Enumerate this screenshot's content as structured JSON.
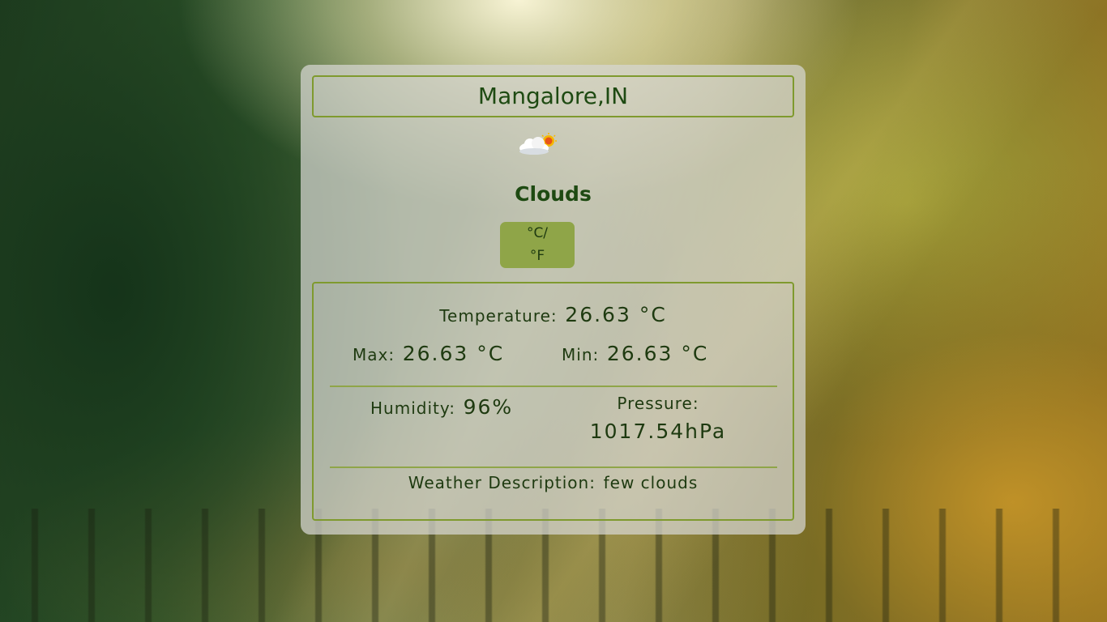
{
  "location": {
    "city_label": "Mangalore,IN"
  },
  "weather": {
    "icon": "cloud-sun-icon",
    "condition": "Clouds"
  },
  "unit_toggle": {
    "celsius": "°C/",
    "fahrenheit": "°F"
  },
  "details": {
    "temperature_label": "Temperature:",
    "temperature_value": "26.63 °C",
    "max_label": "Max:",
    "max_value": "26.63 °C",
    "min_label": "Min:",
    "min_value": "26.63 °C",
    "humidity_label": "Humidity:",
    "humidity_value": "96%",
    "pressure_label": "Pressure:",
    "pressure_value": "1017.54hPa",
    "description_label": "Weather Description:",
    "description_value": "few clouds"
  },
  "colors": {
    "accent": "#8fa548",
    "text_dark_green": "#1e4a12",
    "border": "#7f9a2e"
  }
}
